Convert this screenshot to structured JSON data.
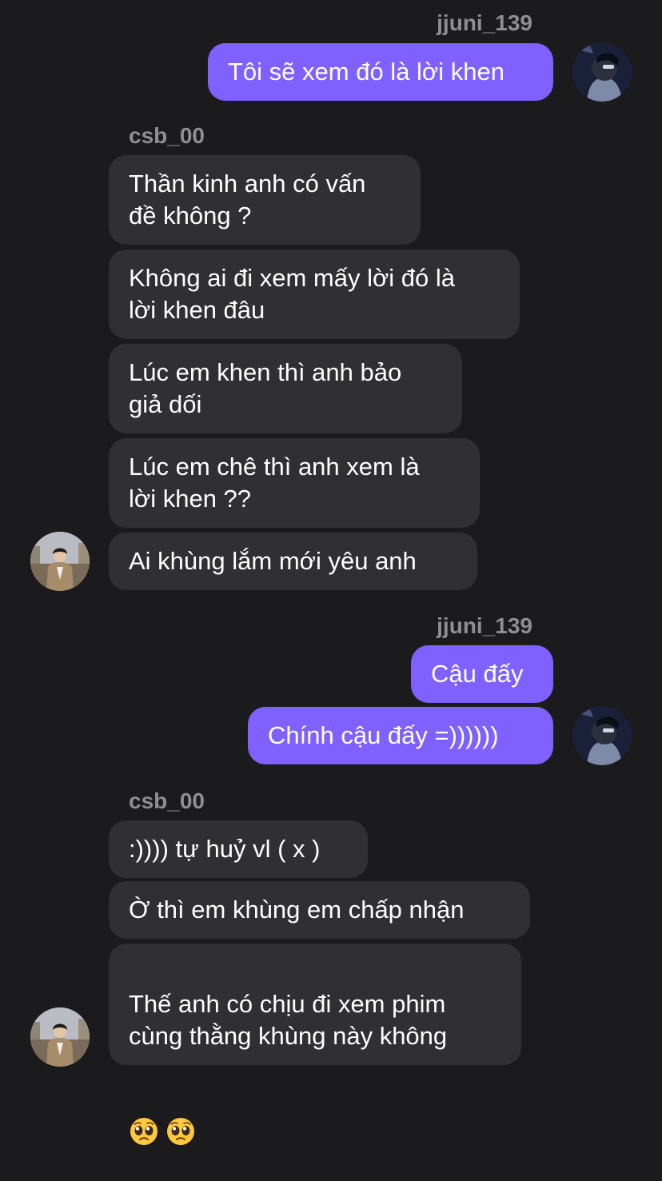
{
  "messages": [
    {
      "sender": "jjuni_139"
    },
    {
      "text": "Tôi sẽ xem đó là lời khen"
    },
    {
      "sender": "csb_00"
    },
    {
      "text": "Thần kinh anh có vấn\nđề không ?"
    },
    {
      "text": "Không ai đi xem mấy lời đó là\nlời khen đâu"
    },
    {
      "text": "Lúc em khen thì anh bảo\ngiả dối"
    },
    {
      "text": "Lúc em chê thì anh xem là\nlời khen ??"
    },
    {
      "text": "Ai khùng lắm mới yêu anh"
    },
    {
      "sender": "jjuni_139"
    },
    {
      "text": "Cậu đấy"
    },
    {
      "text": "Chính cậu đấy =))))))"
    },
    {
      "sender": "csb_00"
    },
    {
      "text": ":)))) tự huỷ vl ( x )"
    },
    {
      "text": "Ờ thì em khùng em chấp nhận"
    },
    {
      "text": "Thế anh có chịu đi xem phim\ncùng thằng khùng này không"
    }
  ],
  "emoji": [
    "pleading-face-emoji",
    "pleading-face-emoji"
  ],
  "colors": {
    "background": "#1b1b1d",
    "outgoing_bubble": "#7f61ff",
    "incoming_bubble": "#303033",
    "sender_label": "#8e8e93"
  },
  "icons": {
    "me_avatar": "avatar-photo",
    "them_avatar": "avatar-photo"
  }
}
